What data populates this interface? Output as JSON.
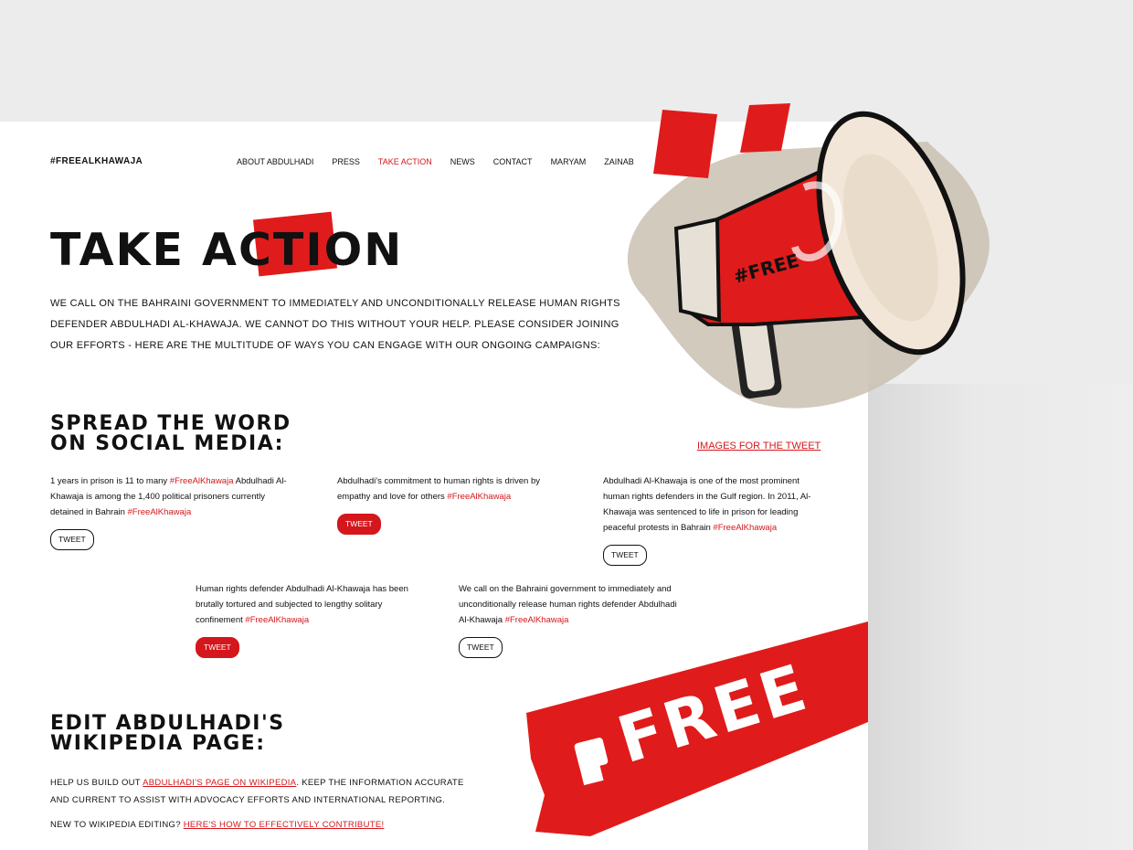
{
  "header": {
    "logo": "#FREEALKHAWAJA",
    "nav": [
      "ABOUT ABDULHADI",
      "PRESS",
      "TAKE ACTION",
      "NEWS",
      "CONTACT",
      "MARYAM",
      "ZAINAB"
    ],
    "active_nav": "TAKE ACTION"
  },
  "hero": {
    "title": "TAKE ACTION",
    "intro": "WE CALL ON THE BAHRAINI GOVERNMENT TO IMMEDIATELY AND UNCONDITIONALLY RELEASE HUMAN RIGHTS DEFENDER ABDULHADI AL-KHAWAJA. WE CANNOT DO THIS WITHOUT YOUR HELP. PLEASE CONSIDER JOINING OUR EFFORTS - HERE ARE THE MULTITUDE OF WAYS YOU CAN ENGAGE WITH OUR ONGOING CAMPAIGNS:"
  },
  "social": {
    "heading_line1": "SPREAD THE WORD",
    "heading_line2": "ON SOCIAL MEDIA:",
    "images_link": "IMAGES FOR THE TWEET",
    "tweets": [
      {
        "text": "1 years in prison is 11 to many ",
        "tag_inline": "#FreeAlKhawaja",
        "text2": " Abdulhadi Al-Khawaja is among the 1,400 political prisoners currently detained in Bahrain ",
        "tag": "#FreeAlKhawaja",
        "button": "TWEET"
      },
      {
        "text": "Abdulhadi's commitment to human rights is driven by empathy and love for others ",
        "tag": "#FreeAlKhawaja",
        "button": "TWEET"
      },
      {
        "text": "Abdulhadi Al-Khawaja is one of the most prominent human rights defenders in the Gulf region.  In 2011, Al-Khawaja was sentenced to life in prison for leading peaceful protests in Bahrain ",
        "tag": "#FreeAlKhawaja",
        "button": "TWEET"
      },
      {
        "text": "Human rights defender Abdulhadi Al-Khawaja has been brutally tortured and subjected to lengthy solitary confinement ",
        "tag": "#FreeAlKhawaja",
        "button": "TWEET"
      },
      {
        "text": "We call on the Bahraini government to immediately and unconditionally release human rights defender Abdulhadi Al-Khawaja ",
        "tag": "#FreeAlKhawaja",
        "button": "TWEET"
      }
    ]
  },
  "wikipedia": {
    "heading_line1": "EDIT ABDULHADI'S",
    "heading_line2": "WIKIPEDIA PAGE:",
    "p1_before": "HELP US BUILD OUT ",
    "p1_link": "ABDULHADI'S PAGE ON WIKIPEDIA",
    "p1_after": ". KEEP THE INFORMATION ACCURATE AND CURRENT TO ASSIST WITH ADVOCACY EFFORTS AND INTERNATIONAL REPORTING.",
    "p2_before": "NEW TO WIKIPEDIA EDITING? ",
    "p2_link": "HERE'S HOW TO EFFECTIVELY CONTRIBUTE!"
  },
  "illustrations": {
    "megaphone_text": "#FREE",
    "banner_text": "FREE"
  },
  "colors": {
    "accent": "#d4171c",
    "background": "#ececec",
    "page": "#ffffff"
  }
}
